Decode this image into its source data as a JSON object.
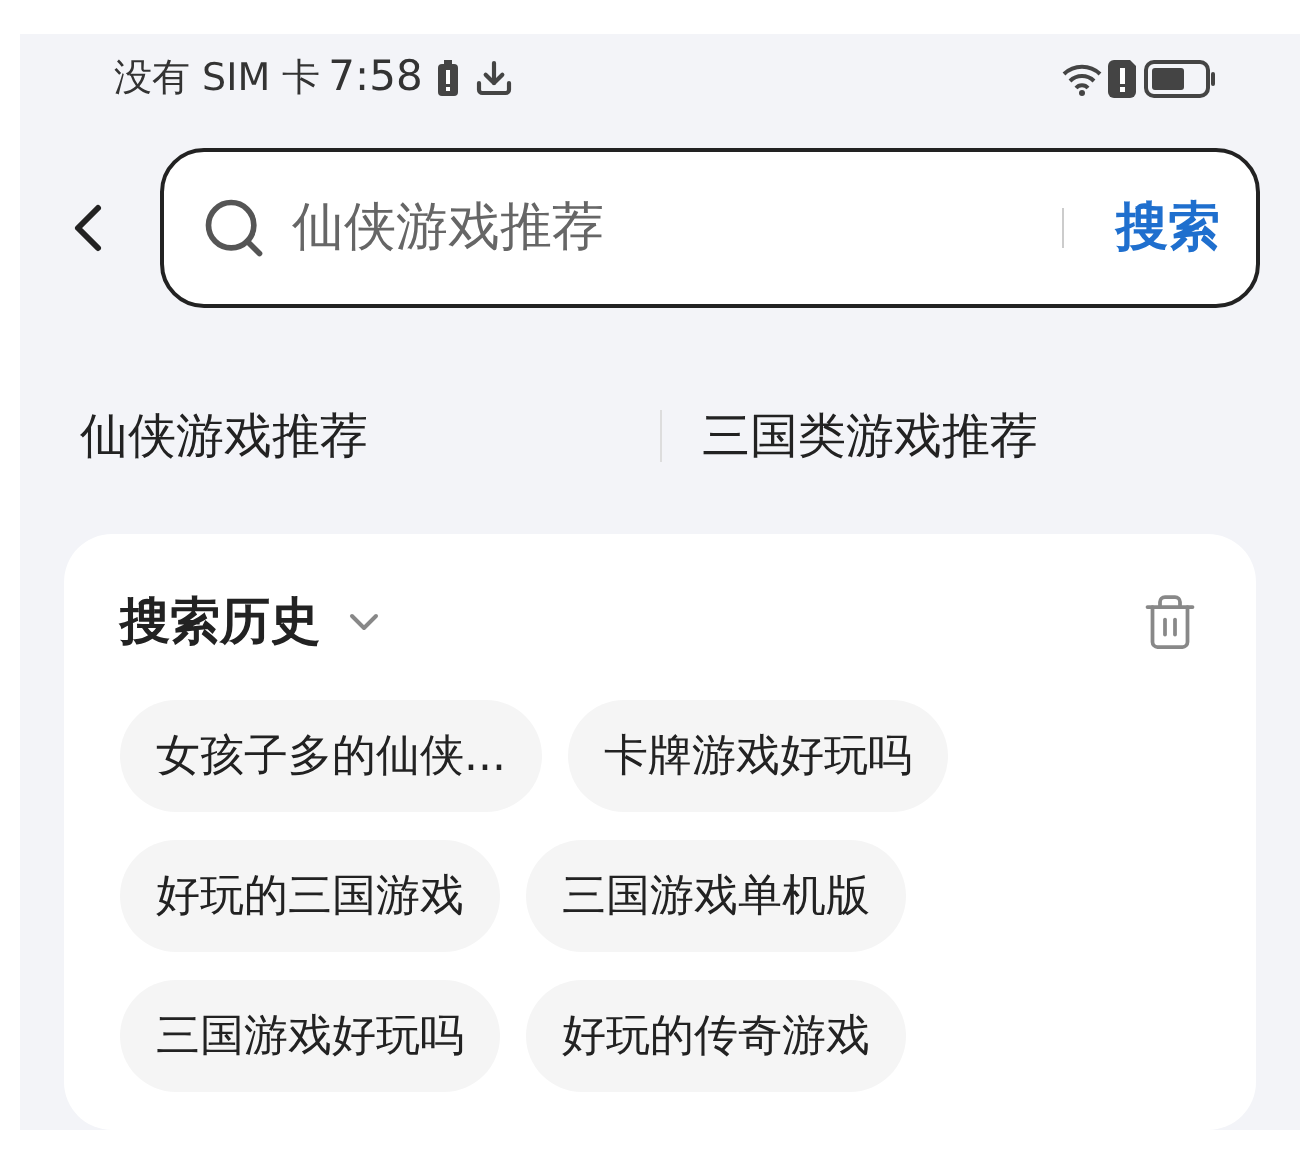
{
  "status_bar": {
    "carrier": "没有 SIM 卡",
    "time": "7:58"
  },
  "search": {
    "placeholder": "仙侠游戏推荐",
    "button": "搜索"
  },
  "suggestions": [
    "仙侠游戏推荐",
    "三国类游戏推荐"
  ],
  "history": {
    "title": "搜索历史",
    "items": [
      "女孩子多的仙侠...",
      "卡牌游戏好玩吗",
      "好玩的三国游戏",
      "三国游戏单机版",
      "三国游戏好玩吗",
      "好玩的传奇游戏"
    ]
  }
}
